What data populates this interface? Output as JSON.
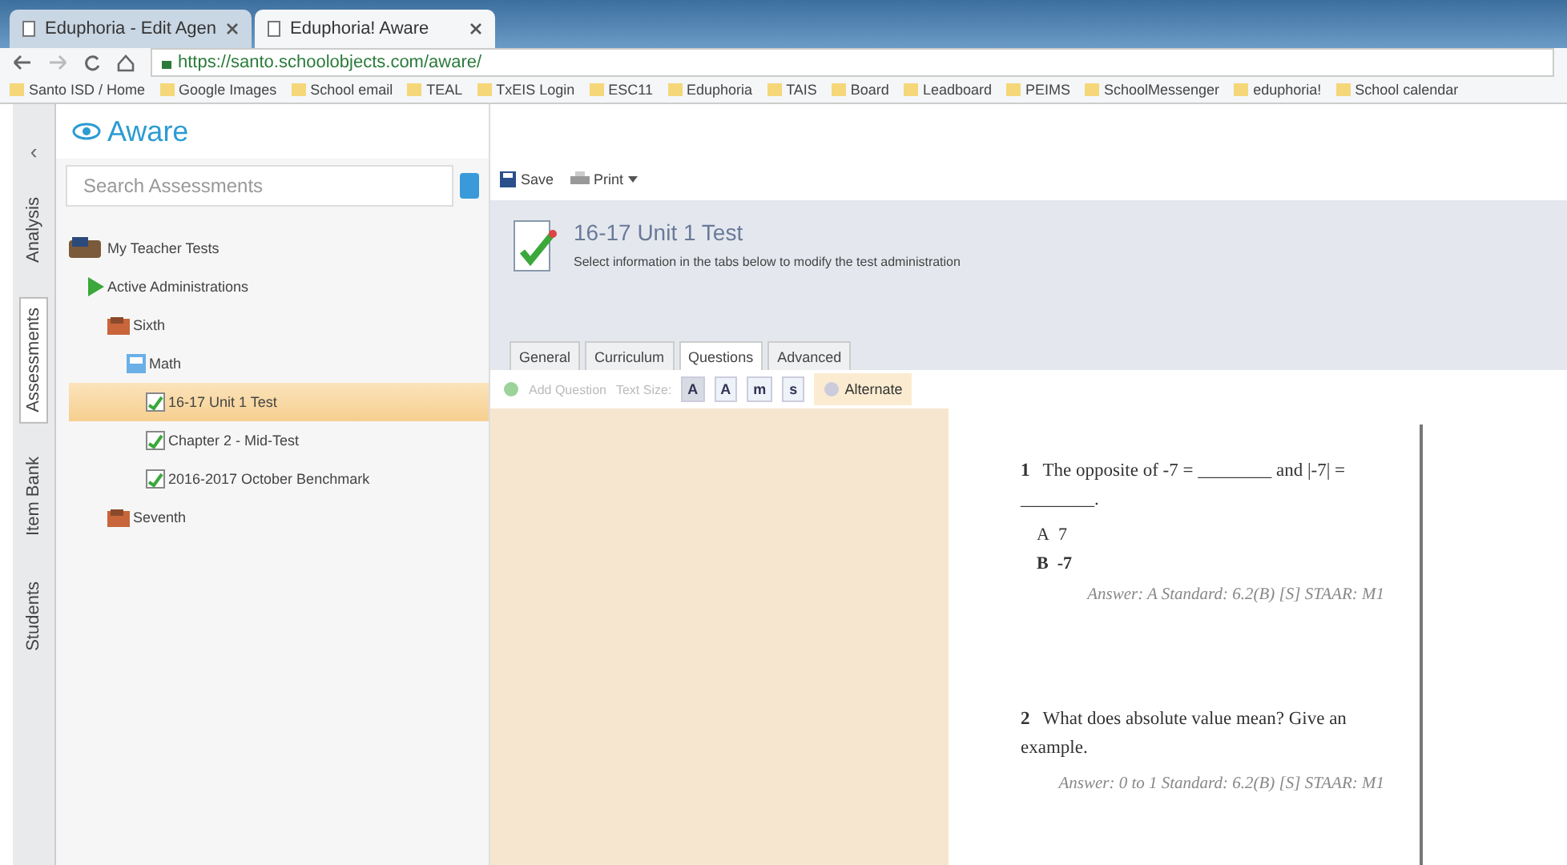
{
  "browser": {
    "tabs": [
      {
        "title": "Eduphoria - Edit Agen",
        "selected": false
      },
      {
        "title": "Eduphoria! Aware",
        "selected": true
      }
    ],
    "url": "https://santo.schoolobjects.com/aware/",
    "bookmarks": [
      "Santo ISD / Home",
      "Google Images",
      "School email",
      "TEAL",
      "TxEIS Login",
      "ESC11",
      "Eduphoria",
      "TAIS",
      "Board",
      "Leadboard",
      "PEIMS",
      "SchoolMessenger",
      "eduphoria!",
      "School calendar"
    ]
  },
  "rail": {
    "collapse": "‹",
    "tabs": [
      {
        "label": "Analysis",
        "selected": false
      },
      {
        "label": "Assessments",
        "selected": true
      },
      {
        "label": "Item Bank",
        "selected": false
      },
      {
        "label": "Students",
        "selected": false
      }
    ]
  },
  "app_title": "Aware",
  "search": {
    "placeholder": "Search Assessments"
  },
  "tree": [
    {
      "label": "My Teacher Tests",
      "kind": "root",
      "selected": false,
      "children": [
        {
          "label": "Active Administrations",
          "kind": "play",
          "selected": false,
          "children": [
            {
              "label": "Sixth",
              "kind": "grade",
              "selected": false,
              "children": [
                {
                  "label": "Math",
                  "kind": "subject",
                  "selected": false,
                  "children": [
                    {
                      "label": "16-17 Unit 1 Test",
                      "kind": "test",
                      "selected": true
                    },
                    {
                      "label": "Chapter 2 - Mid-Test",
                      "kind": "test",
                      "selected": false
                    },
                    {
                      "label": "2016-2017 October Benchmark",
                      "kind": "test",
                      "selected": false
                    }
                  ]
                }
              ]
            },
            {
              "label": "Seventh",
              "kind": "grade",
              "selected": false
            }
          ]
        }
      ]
    }
  ],
  "toolbar": {
    "save": "Save",
    "print": "Print"
  },
  "header": {
    "title": "16-17 Unit 1 Test",
    "subtitle": "Select information in the tabs below to modify the test administration"
  },
  "tabs": [
    {
      "label": "General",
      "selected": false
    },
    {
      "label": "Curriculum",
      "selected": false
    },
    {
      "label": "Questions",
      "selected": true
    },
    {
      "label": "Advanced",
      "selected": false
    }
  ],
  "question_toolbar": {
    "add": "Add Question",
    "text_size": "Text Size:",
    "sizes": [
      {
        "label": "A",
        "selected": true
      },
      {
        "label": "A",
        "selected": false
      },
      {
        "label": "m",
        "selected": false
      },
      {
        "label": "s",
        "selected": false
      }
    ],
    "alternate": {
      "label": "Alternate",
      "selected": true
    }
  },
  "questions": [
    {
      "number": "1",
      "text": "The opposite of -7 = ________ and |-7| = ________.",
      "choices": [
        {
          "letter": "A",
          "text": "7",
          "selected": false
        },
        {
          "letter": "B",
          "text": "-7",
          "selected": true
        }
      ],
      "answer": "Answer: A Standard: 6.2(B) [S] STAAR: M1"
    },
    {
      "number": "2",
      "text": "What does absolute value mean? Give an example.",
      "answer": "Answer: 0 to 1 Standard: 6.2(B) [S] STAAR: M1"
    }
  ]
}
